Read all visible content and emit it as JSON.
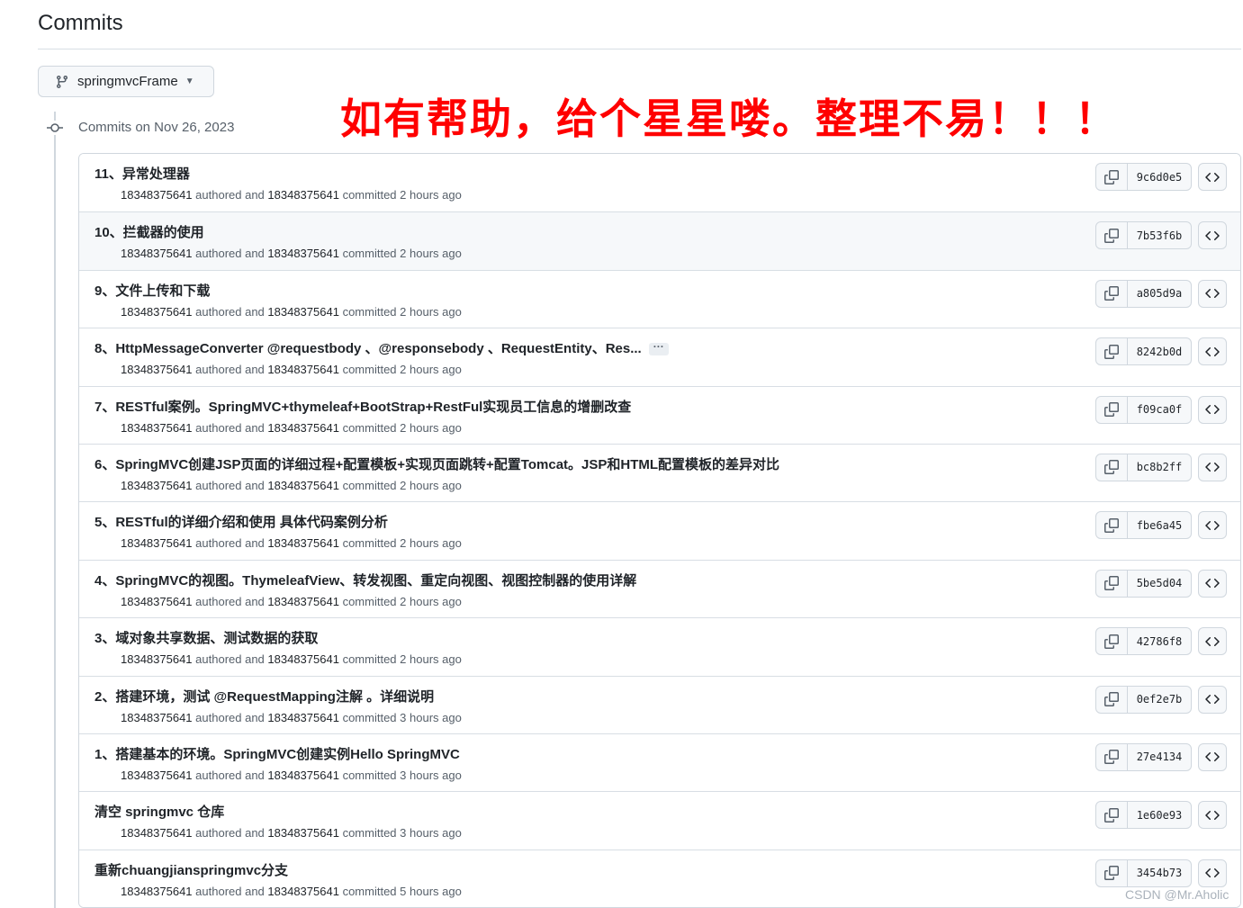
{
  "page_title": "Commits",
  "branch": {
    "name": "springmvcFrame",
    "icon": "git-branch-icon"
  },
  "banner": "如有帮助，给个星星喽。整理不易！！！",
  "date_header": "Commits on Nov 26, 2023",
  "colors": {
    "banner": "#ff0000",
    "border": "#d0d7de",
    "muted": "#57606a",
    "text": "#1f2328"
  },
  "commits": [
    {
      "message": "11、异常处理器",
      "author": "18348375641",
      "committer": "18348375641",
      "time": "2 hours ago",
      "sha": "9c6d0e5"
    },
    {
      "message": "10、拦截器的使用",
      "author": "18348375641",
      "committer": "18348375641",
      "time": "2 hours ago",
      "sha": "7b53f6b"
    },
    {
      "message": "9、文件上传和下载",
      "author": "18348375641",
      "committer": "18348375641",
      "time": "2 hours ago",
      "sha": "a805d9a"
    },
    {
      "message": "8、HttpMessageConverter @requestbody 、@responsebody 、RequestEntity、Res...",
      "author": "18348375641",
      "committer": "18348375641",
      "time": "2 hours ago",
      "sha": "8242b0d",
      "truncated": true
    },
    {
      "message": "7、RESTful案例。SpringMVC+thymeleaf+BootStrap+RestFul实现员工信息的增删改查",
      "author": "18348375641",
      "committer": "18348375641",
      "time": "2 hours ago",
      "sha": "f09ca0f"
    },
    {
      "message": "6、SpringMVC创建JSP页面的详细过程+配置模板+实现页面跳转+配置Tomcat。JSP和HTML配置模板的差异对比",
      "author": "18348375641",
      "committer": "18348375641",
      "time": "2 hours ago",
      "sha": "bc8b2ff"
    },
    {
      "message": "5、RESTful的详细介绍和使用 具体代码案例分析",
      "author": "18348375641",
      "committer": "18348375641",
      "time": "2 hours ago",
      "sha": "fbe6a45"
    },
    {
      "message": "4、SpringMVC的视图。ThymeleafView、转发视图、重定向视图、视图控制器的使用详解",
      "author": "18348375641",
      "committer": "18348375641",
      "time": "2 hours ago",
      "sha": "5be5d04"
    },
    {
      "message": "3、域对象共享数据、测试数据的获取",
      "author": "18348375641",
      "committer": "18348375641",
      "time": "2 hours ago",
      "sha": "42786f8"
    },
    {
      "message": "2、搭建环境，测试 @RequestMapping注解 。详细说明",
      "author": "18348375641",
      "committer": "18348375641",
      "time": "3 hours ago",
      "sha": "0ef2e7b"
    },
    {
      "message": "1、搭建基本的环境。SpringMVC创建实例Hello SpringMVC",
      "author": "18348375641",
      "committer": "18348375641",
      "time": "3 hours ago",
      "sha": "27e4134"
    },
    {
      "message": "清空 springmvc 仓库",
      "author": "18348375641",
      "committer": "18348375641",
      "time": "3 hours ago",
      "sha": "1e60e93"
    },
    {
      "message": "重新chuangjianspringmvc分支",
      "author": "18348375641",
      "committer": "18348375641",
      "time": "5 hours ago",
      "sha": "3454b73"
    }
  ],
  "meta_words": {
    "authored": "authored and",
    "committed": "committed"
  },
  "ellipsis": "···",
  "watermark": "CSDN @Mr.Aholic"
}
